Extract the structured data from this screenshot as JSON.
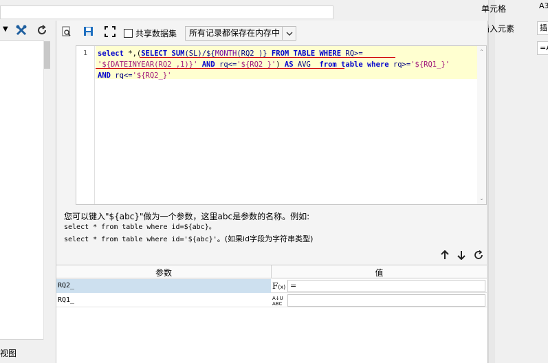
{
  "background": {
    "left_bottom_label": "视图",
    "right_labels": [
      "单元格",
      "插入元素"
    ],
    "right_values": [
      "A3",
      "插",
      "=A"
    ]
  },
  "toolbar": {
    "share_dataset_label": "共享数据集",
    "cache_select_value": "所有记录都保存在内存中"
  },
  "editor": {
    "line_number": "1",
    "tokens": {
      "t1": "select",
      "t2": " *,(",
      "t3": "SELECT",
      "t4": " ",
      "t5": "SUM",
      "t6": "(SL)/${",
      "t7": "MONTH",
      "t8": "(RQ2_)}",
      "t9": " FROM TABLE WHERE",
      "t10": " RQ>=",
      "t11": "'${DATEINYEAR(RQ2_,1)}'",
      "t12": " AND",
      "t13": " rq<=",
      "t14": "'${RQ2_}'",
      "t15": ")",
      "t16": " AS",
      "t17": " AVG_",
      "t18": " from table where",
      "t19": " rq>=",
      "t20": "'${RQ1_}'",
      "t21": "AND",
      "t22": " rq<=",
      "t23": "'${RQ2_}'"
    }
  },
  "help": {
    "line1": "您可以键入\"${abc}\"做为一个参数，这里abc是参数的名称。例如:",
    "line2": "select * from table where id=${abc}。",
    "line3_code": "select * from table where id='${abc}'",
    "line3_note": "。(如果id字段为字符串类型)"
  },
  "params_table": {
    "headers": [
      "参数",
      "值"
    ],
    "rows": [
      {
        "name": "RQ2_",
        "icon": "formula-icon",
        "icon_text": "F(x)",
        "value": "="
      },
      {
        "name": "RQ1_",
        "icon": "text-type-icon",
        "icon_text": "ABC",
        "value": ""
      }
    ]
  }
}
